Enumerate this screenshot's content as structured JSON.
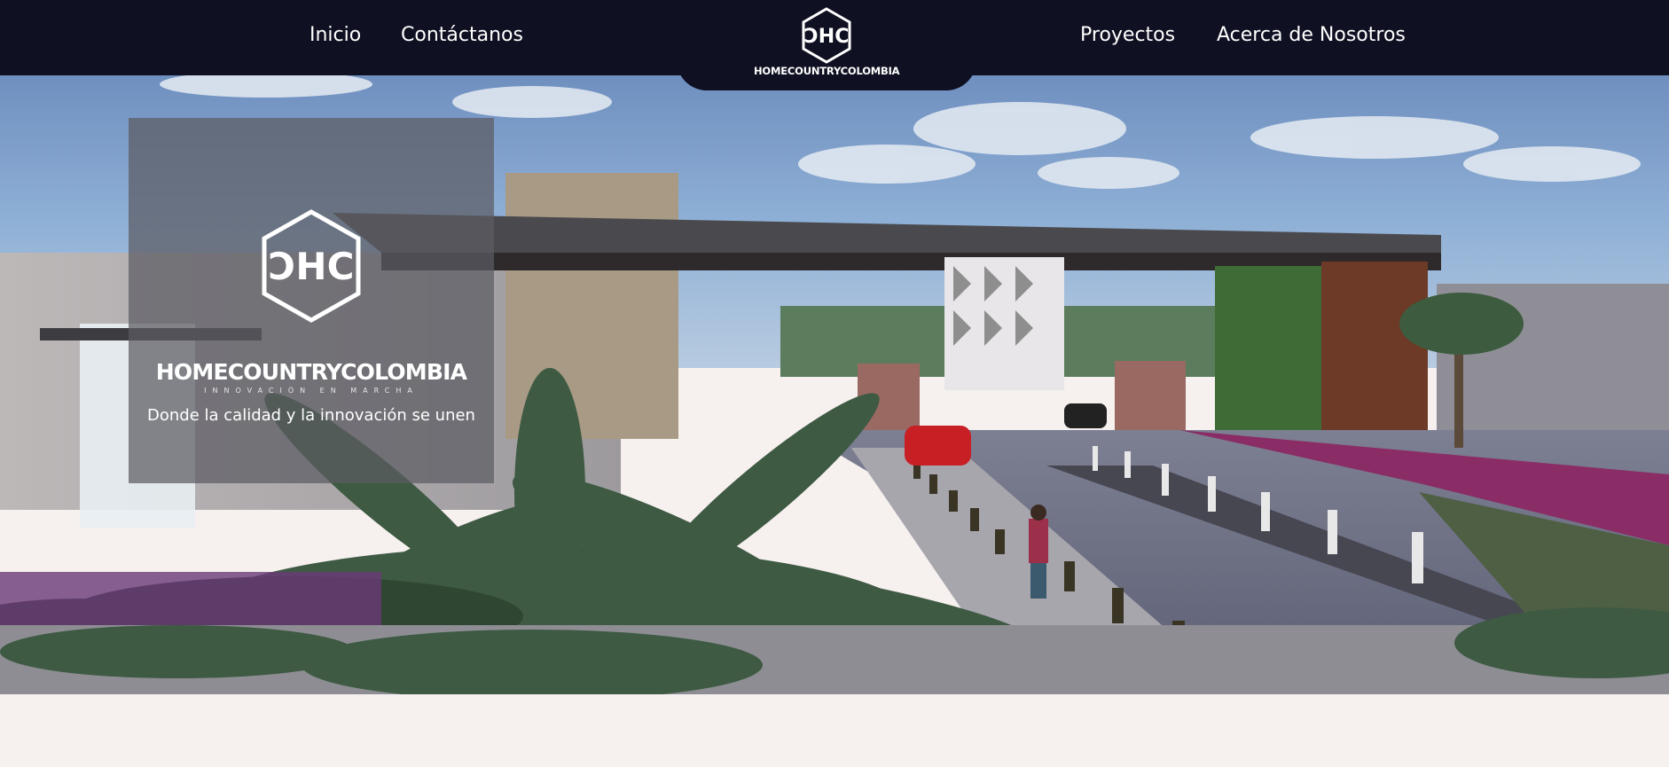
{
  "nav": {
    "left_links": [
      {
        "label": "Inicio"
      },
      {
        "label": "Contáctanos"
      }
    ],
    "right_links": [
      {
        "label": "Proyectos"
      },
      {
        "label": "Acerca de Nosotros"
      }
    ],
    "logo": {
      "brand": "HOMECOUNTRYCOLOMBIA",
      "icon": "hexagon-hc-logo-icon"
    }
  },
  "hero": {
    "background": "rendering of a gated community entrance with palm trees, road, pedestrians and red car",
    "overlay": {
      "brand": "HOMECOUNTRYCOLOMBIA",
      "subtitle": "INNOVACIÓN EN MARCHA",
      "tagline": "Donde la calidad y la innovación se unen",
      "icon": "hexagon-hc-logo-icon"
    }
  },
  "colors": {
    "navbar": "#0f1022",
    "page_bg": "#f6f0ef",
    "overlay": "#5c5c62"
  }
}
